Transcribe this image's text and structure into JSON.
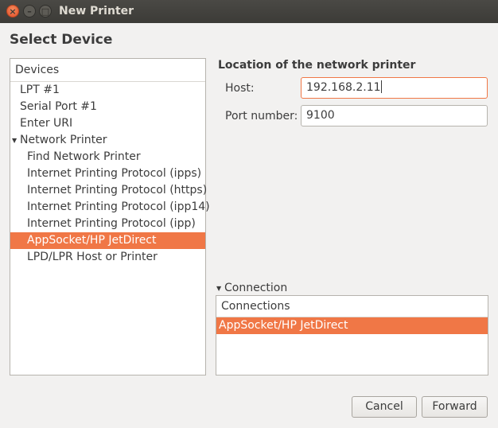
{
  "window": {
    "title": "New Printer",
    "close_glyph": "×",
    "min_glyph": "–",
    "max_glyph": "□"
  },
  "page_title": "Select Device",
  "devices": {
    "header": "Devices",
    "items": [
      {
        "label": "LPT #1"
      },
      {
        "label": "Serial Port #1"
      },
      {
        "label": "Enter URI"
      },
      {
        "label": "Network Printer",
        "expanded": true
      },
      {
        "label": "Find Network Printer"
      },
      {
        "label": "Internet Printing Protocol (ipps)"
      },
      {
        "label": "Internet Printing Protocol (https)"
      },
      {
        "label": "Internet Printing Protocol (ipp14)"
      },
      {
        "label": "Internet Printing Protocol (ipp)"
      },
      {
        "label": "AppSocket/HP JetDirect",
        "selected": true
      },
      {
        "label": "LPD/LPR Host or Printer"
      }
    ]
  },
  "location": {
    "title": "Location of the network printer",
    "host_label": "Host:",
    "host_value": "192.168.2.11",
    "port_label": "Port number:",
    "port_value": "9100"
  },
  "connection": {
    "expander_label": "Connection",
    "header": "Connections",
    "items": [
      {
        "label": "AppSocket/HP JetDirect",
        "selected": true
      }
    ]
  },
  "buttons": {
    "cancel": "Cancel",
    "forward": "Forward"
  },
  "colors": {
    "accent": "#f07746",
    "titlebar": "#3c3b37"
  }
}
